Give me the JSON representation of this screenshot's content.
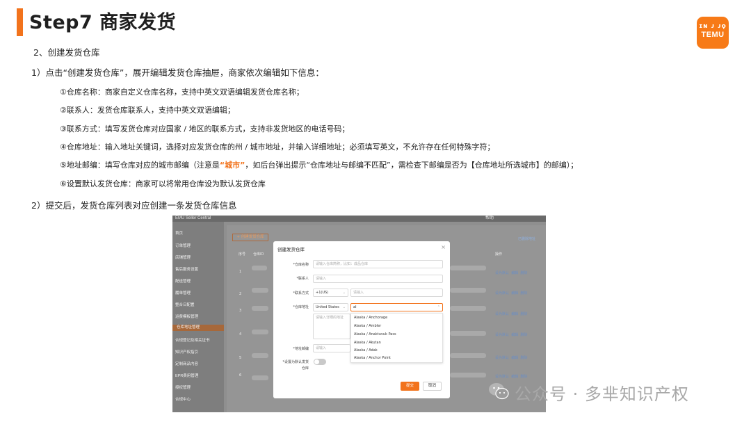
{
  "slide": {
    "title": "Step7 商家发货",
    "section": "2、创建发货仓库",
    "step1": "1）点击“创建发货仓库”，展开编辑发货仓库抽屉，商家依次编辑如下信息：",
    "items": {
      "i1": "①仓库名称：商家自定义仓库名称，支持中英文双语编辑发货仓库名称；",
      "i2": "②联系人：发货仓库联系人，支持中英文双语编辑；",
      "i3": "③联系方式：填写发货仓库对应国家 / 地区的联系方式，支持非发货地区的电话号码；",
      "i4": "④仓库地址：输入地址关键词，选择对应发货仓库的州 / 城市地址，并输入详细地址；必须填写英文，不允许存在任何特殊字符；",
      "i5_pre": "⑤地址邮编：填写仓库对应的城市邮编（注意是",
      "i5_hl": "“城市”",
      "i5_post": "，如后台弹出提示“仓库地址与邮编不匹配”，需检查下邮编是否为【仓库地址所选城市】的邮编）；",
      "i6": "⑥设置默认发货仓库：商家可以将常用仓库设为默认发货仓库"
    },
    "step2": "2）提交后，发货仓库列表对应创建一条发货仓库信息"
  },
  "logo": {
    "top": "ɪɴ ᴊ ᴊǫ",
    "text": "TEMU",
    "color": "#f77a17"
  },
  "screenshot": {
    "topbar": {
      "brand": "EMU Seller Central",
      "right": "帮助"
    },
    "sidebar": [
      "首页",
      "订单管理",
      "店铺管理",
      "售后服务设置",
      "配送管理",
      "履单管理",
      "整合日配置",
      "运费模板管理",
      "仓库地址管理",
      "合规登记及相关证书",
      "知识产权指引",
      "定制商品内容",
      "EPR费用管理",
      "授权管理",
      "合规中心"
    ],
    "sidebar_active": "仓库地址管理",
    "create_button": "+ 创建发货仓库",
    "columns": {
      "num": "序号",
      "id": "仓库ID",
      "ops": "操作"
    },
    "deleted_link": "已删除地址",
    "rows": [
      "1",
      "2",
      "3",
      "4",
      "5",
      "6"
    ],
    "row_actions": {
      "set_default": "设为默认",
      "edit": "编辑",
      "delete": "删除"
    },
    "modal": {
      "title": "创建发货仓库",
      "close": "×",
      "name_label": "*仓库名称",
      "name_placeholder": "请输入仓库简称，比如：成品仓库",
      "contact_label": "*联系人",
      "contact_placeholder": "请输入",
      "phone_label": "*联系方式",
      "phone_code": "+1(US)",
      "phone_placeholder": "请输入",
      "addr_label": "*仓库地址",
      "country": "United States",
      "search_value": "al",
      "detail_placeholder": "请输入详细的地址",
      "zip_label": "*地址邮编",
      "zip_placeholder": "请输入",
      "default_label_1": "*设置为默认发货",
      "default_label_2": "仓库",
      "options": [
        "Alaska / Anchorage",
        "Alaska / Ambler",
        "Alaska / Anaktuvuk Pass",
        "Alaska / Akutan",
        "Alaska / Adak",
        "Alaska / Anchor Point"
      ],
      "submit": "提交",
      "cancel": "取消"
    }
  },
  "watermark": {
    "text": "公众号 · 多芈知识产权",
    "icon": "wechat-icon"
  }
}
